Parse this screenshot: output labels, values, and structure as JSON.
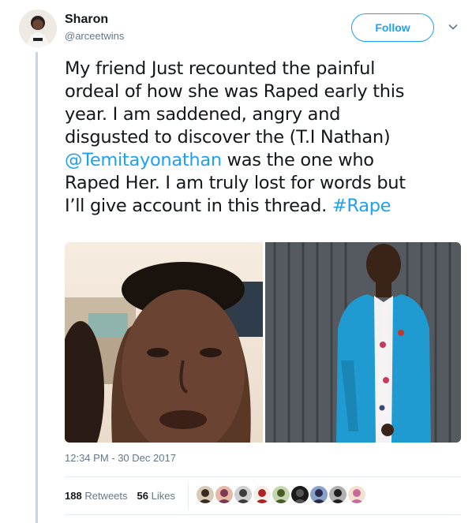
{
  "author": {
    "display_name": "Sharon",
    "handle": "@arceetwins"
  },
  "follow_label": "Follow",
  "tweet": {
    "lines": [
      [
        {
          "t": "My friend Just recounted the painful"
        }
      ],
      [
        {
          "t": "ordeal of how she was Raped early this"
        }
      ],
      [
        {
          "t": "year. I am saddened, angry and"
        }
      ],
      [
        {
          "t": "disgusted to discover the (T.I Nathan)"
        }
      ],
      [
        {
          "t": "@Temitayonathan",
          "link": true
        },
        {
          "t": " was the one who"
        }
      ],
      [
        {
          "t": "Raped Her. I am truly lost for words but"
        }
      ],
      [
        {
          "t": "I’ll give account in this thread. "
        },
        {
          "t": "#Rape",
          "link": true
        }
      ]
    ]
  },
  "timestamp": "12:34 PM - 30 Dec 2017",
  "stats": {
    "retweets_count": "188",
    "retweets_label": "Retweets",
    "likes_count": "56",
    "likes_label": "Likes"
  },
  "likers": [
    {
      "bg": "#d9c9b8",
      "fg": "#3a2a1f"
    },
    {
      "bg": "#e7b8a8",
      "fg": "#7a3b52"
    },
    {
      "bg": "#cfcfcf",
      "fg": "#3d3d3d"
    },
    {
      "bg": "#f4efe6",
      "fg": "#b22222"
    },
    {
      "bg": "#c6d7b0",
      "fg": "#4a5a2a"
    },
    {
      "bg": "#1b1b1b",
      "fg": "#555555"
    },
    {
      "bg": "#8aa2c8",
      "fg": "#2b2b4b"
    },
    {
      "bg": "#b0b0b0",
      "fg": "#1f1f1f"
    },
    {
      "bg": "#f3e1d3",
      "fg": "#c96a9a"
    }
  ],
  "colors": {
    "accent": "#1da1f2",
    "muted": "#657786",
    "thread_line": "#c4d6e4"
  }
}
